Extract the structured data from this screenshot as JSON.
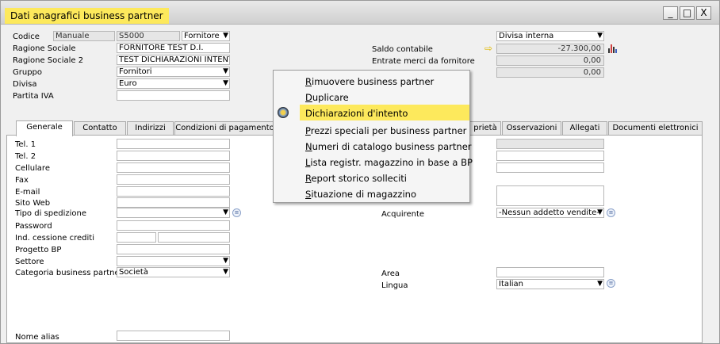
{
  "window": {
    "title": "Dati anagrafici business partner",
    "buttons": [
      "_",
      "□",
      "X"
    ]
  },
  "header": {
    "codice": {
      "label": "Codice",
      "series": "Manuale",
      "value": "S5000",
      "type": "Fornitore"
    },
    "ragione_sociale": {
      "label": "Ragione Sociale",
      "value": "FORNITORE TEST D.I."
    },
    "ragione_sociale_2": {
      "label": "Ragione Sociale 2",
      "value": "TEST DICHIARAZIONI INTENT"
    },
    "gruppo": {
      "label": "Gruppo",
      "value": "Fornitori"
    },
    "divisa": {
      "label": "Divisa",
      "value": "Euro"
    },
    "partita_iva": {
      "label": "Partita IVA",
      "value": ""
    },
    "divisa_interna": "Divisa interna",
    "saldo_contabile": {
      "label": "Saldo contabile",
      "value": "-27.300,00"
    },
    "entrate_merci": {
      "label": "Entrate merci da fornitore",
      "value": "0,00"
    },
    "third_row": {
      "label": "",
      "value": "0,00"
    }
  },
  "tabs": [
    "Generale",
    "Contatto",
    "Indirizzi",
    "Condizioni di pagamento",
    "prietà",
    "Osservazioni",
    "Allegati",
    "Documenti elettronici"
  ],
  "general": {
    "left_labels": [
      "Tel. 1",
      "Tel. 2",
      "Cellulare",
      "Fax",
      "E-mail",
      "Sito Web",
      "Tipo di spedizione",
      "Password",
      "Ind. cessione crediti",
      "Progetto BP",
      "Settore",
      "Categoria business partner"
    ],
    "categoria_value": "Società",
    "nome_alias": "Nome alias",
    "acquirente": {
      "label": "Acquirente",
      "value": "-Nessun addetto vendite-"
    },
    "area": {
      "label": "Area",
      "value": ""
    },
    "lingua": {
      "label": "Lingua",
      "value": "Italian"
    }
  },
  "context_menu": [
    {
      "label": "Rimuovere business partner",
      "accel": "R",
      "rest": "imuovere business partner"
    },
    {
      "label": "Duplicare",
      "accel": "D",
      "rest": "uplicare"
    },
    {
      "label": "Dichiarazioni d'intento",
      "accel": "",
      "rest": "Dichiarazioni d'intento",
      "highlighted": true,
      "icon": "declaration-icon"
    },
    {
      "label": "Prezzi speciali per business partner",
      "accel": "P",
      "rest": "rezzi speciali per business partner"
    },
    {
      "label": "Numeri di catalogo business partner",
      "accel": "N",
      "rest": "umeri di catalogo business partner"
    },
    {
      "label": "Lista registr. magazzino in base a BP",
      "accel": "L",
      "rest": "ista registr. magazzino in base a BP"
    },
    {
      "label": "Report storico solleciti",
      "accel": "R",
      "rest": "eport storico solleciti"
    },
    {
      "label": "Situazione di magazzino",
      "accel": "S",
      "rest": "ituazione di magazzino"
    }
  ],
  "colors": {
    "highlight": "#fde95c",
    "field_border": "#b7b7b7"
  }
}
